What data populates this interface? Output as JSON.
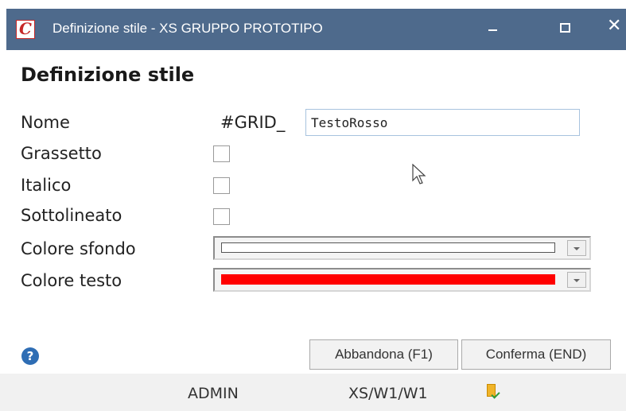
{
  "window": {
    "title": "Definizione stile - XS  GRUPPO PROTOTIPO",
    "app_icon_letter": "C",
    "close_glyph": "✕"
  },
  "form": {
    "heading": "Definizione stile",
    "nome": {
      "label": "Nome",
      "prefix": "#GRID_",
      "value": "TestoRosso"
    },
    "grassetto": {
      "label": "Grassetto",
      "checked": false
    },
    "italico": {
      "label": "Italico",
      "checked": false
    },
    "sottolineato": {
      "label": "Sottolineato",
      "checked": false
    },
    "colore_sfondo": {
      "label": "Colore sfondo",
      "color": "#ffffff"
    },
    "colore_testo": {
      "label": "Colore testo",
      "color": "#ff0000"
    }
  },
  "footer": {
    "help_glyph": "?",
    "abbandona_label": "Abbandona (F1)",
    "conferma_label": "Conferma (END)"
  },
  "statusbar": {
    "user": "ADMIN",
    "path": "XS/W1/W1",
    "icon": "document-check-icon"
  },
  "colors": {
    "titlebar": "#4e6a8c",
    "accent_red": "#ff0000",
    "help_blue": "#2e6db4"
  }
}
